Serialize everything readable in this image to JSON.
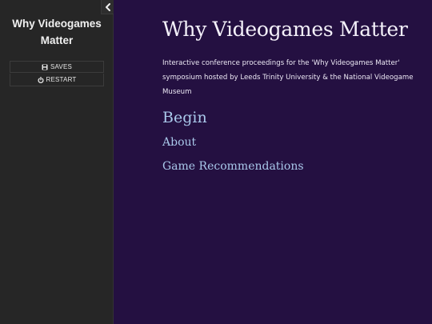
{
  "sidebar": {
    "title": "Why Videogames Matter",
    "toggle_icon": "chevron-left-icon",
    "saves_label": "SAVES",
    "saves_icon": "floppy-disk-icon",
    "restart_label": "RESTART",
    "restart_icon": "power-icon"
  },
  "passage": {
    "title": "Why Videogames Matter",
    "intro": "Interactive conference proceedings for the 'Why Videogames Matter' symposium hosted by Leeds Trinity University & the National Videogame Museum",
    "links": {
      "begin": "Begin",
      "about": "About",
      "recommendations": "Game Recommendations"
    }
  },
  "colors": {
    "sidebar_bg": "#262626",
    "passage_bg": "#241041",
    "link": "#a9c8ea",
    "text": "#ece8f4"
  }
}
